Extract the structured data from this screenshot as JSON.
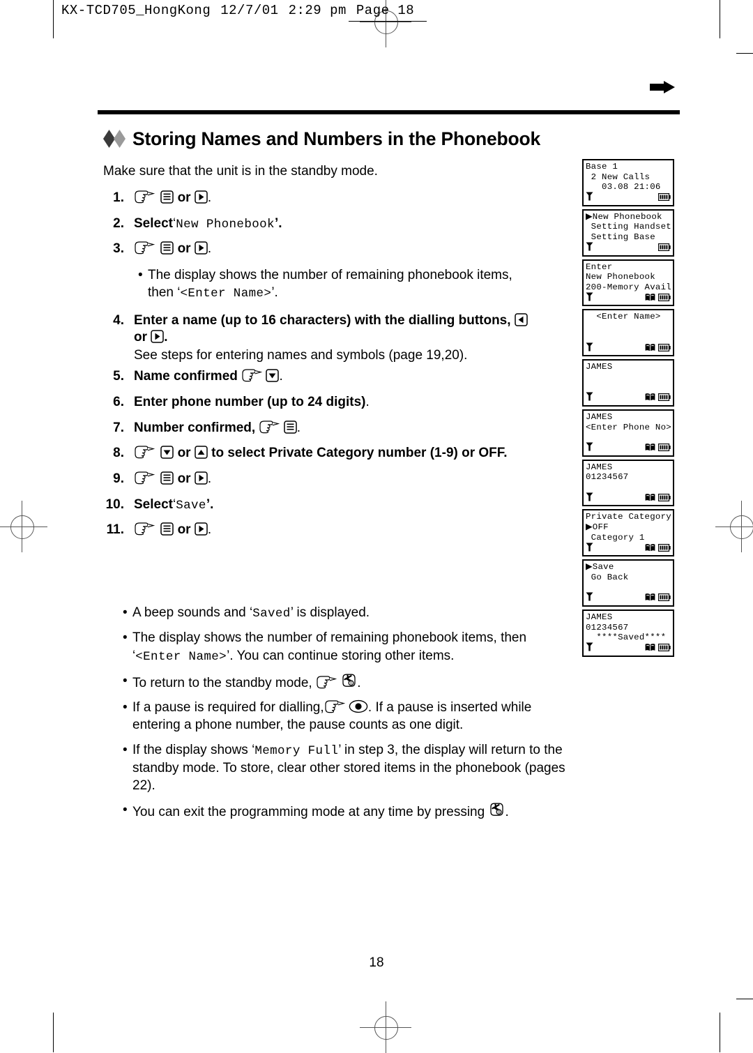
{
  "printer_slug": {
    "job": "KX-TCD705_HongKong",
    "date": "12/7/01",
    "time": "2:29 pm",
    "page_label": "Page 18"
  },
  "page": {
    "title": "Storing Names and Numbers in the Phonebook",
    "intro": "Make sure that the unit is in the standby mode.",
    "folio": "18",
    "arrow_icon": "right-arrow-icon"
  },
  "steps": [
    {
      "num": "1.",
      "kind": "icons",
      "prefix": "",
      "icons": [
        "hand-pointer-icon",
        "menu-key-icon"
      ],
      "joiner": "or",
      "icon2": "right-key-icon",
      "suffix": "."
    },
    {
      "num": "2.",
      "kind": "select",
      "label": "Select",
      "quote_open": "‘",
      "value": "New Phonebook",
      "quote_close": "’."
    },
    {
      "num": "3.",
      "kind": "icons",
      "prefix": "",
      "icons": [
        "hand-pointer-icon",
        "menu-key-icon"
      ],
      "joiner": "or",
      "icon2": "right-key-icon",
      "suffix": "."
    },
    {
      "num": "4.",
      "kind": "text",
      "text_a": "Enter a name (up to 16 characters) with the dialling buttons,",
      "joiner": "or",
      "suffix": ".",
      "note": "See steps for entering names and symbols (page 19,20)."
    },
    {
      "num": "5.",
      "kind": "text",
      "text_a": "Name confirmed",
      "suffix": "."
    },
    {
      "num": "6.",
      "kind": "text",
      "text_a": "Enter phone number (up to 24 digits)",
      "suffix": "."
    },
    {
      "num": "7.",
      "kind": "text",
      "text_a": "Number confirmed,",
      "suffix": "."
    },
    {
      "num": "8.",
      "kind": "text",
      "text_a": "to select Private Category number (1-9) or OFF.",
      "joiner": "or"
    },
    {
      "num": "9.",
      "kind": "icons",
      "prefix": "",
      "icons": [
        "hand-pointer-icon",
        "menu-key-icon"
      ],
      "joiner": "or",
      "icon2": "right-key-icon",
      "suffix": "."
    },
    {
      "num": "10.",
      "kind": "select",
      "label": "Select",
      "quote_open": "‘",
      "value": "Save",
      "quote_close": "’."
    },
    {
      "num": "11.",
      "kind": "icons",
      "prefix": "",
      "icons": [
        "hand-pointer-icon",
        "menu-key-icon"
      ],
      "joiner": "or",
      "icon2": "right-key-icon",
      "suffix": "."
    }
  ],
  "step3_note": {
    "line1": "The display shows the number of remaining phonebook items,",
    "line2_pre": "then ‘",
    "line2_mono": "<Enter Name>",
    "line2_post": "’."
  },
  "notes": [
    {
      "id": "note-beep",
      "pre": "A beep sounds and ‘",
      "mono": "Saved",
      "post": "’ is displayed."
    },
    {
      "id": "note-remaining",
      "pre": "The display shows the number of remaining phonebook items, then ‘",
      "mono": "<Enter Name>",
      "post": "’. You can continue storing other items."
    },
    {
      "id": "note-standby",
      "pre": "To return to the standby mode,",
      "post": "."
    },
    {
      "id": "note-pause",
      "pre": "If a pause is required for dialling,",
      "post": ". If a pause is inserted while entering a phone number, the pause counts as one digit."
    },
    {
      "id": "note-memory-full",
      "pre": "If the display shows ‘",
      "mono": "Memory Full",
      "post": "’ in step 3, the display will return to the standby mode. To store, clear other stored items in the phonebook (pages 22)."
    },
    {
      "id": "note-exit",
      "pre": "You can exit the programming mode at any time by pressing",
      "post": "."
    }
  ],
  "lcd_screens": [
    {
      "id": "lcd-standby",
      "lines": [
        "Base 1",
        " 2 New Calls",
        "   03.08 21:06"
      ],
      "status_left": "antenna-icon",
      "status_right": [
        "battery-icon"
      ]
    },
    {
      "id": "lcd-main-menu",
      "lines": [
        "▶New Phonebook",
        " Setting Handset",
        " Setting Base"
      ],
      "status_left": "antenna-icon",
      "status_right": [
        "battery-icon"
      ]
    },
    {
      "id": "lcd-enter-new-phonebook",
      "lines": [
        "Enter",
        "New Phonebook",
        "200-Memory Avail"
      ],
      "status_left": "antenna-icon",
      "status_right": [
        "phonebook-icon",
        "battery-icon"
      ]
    },
    {
      "id": "lcd-enter-name",
      "lines": [
        "  <Enter Name>",
        "",
        ""
      ],
      "status_left": "antenna-icon",
      "status_right": [
        "phonebook-icon",
        "battery-icon"
      ]
    },
    {
      "id": "lcd-name-james",
      "lines": [
        "JAMES",
        "",
        ""
      ],
      "status_left": "antenna-icon",
      "status_right": [
        "phonebook-icon",
        "battery-icon"
      ]
    },
    {
      "id": "lcd-enter-phone-no",
      "lines": [
        "JAMES",
        "<Enter Phone No>",
        ""
      ],
      "status_left": "antenna-icon",
      "status_right": [
        "phonebook-icon",
        "battery-icon"
      ]
    },
    {
      "id": "lcd-number-entered",
      "lines": [
        "JAMES",
        "01234567",
        ""
      ],
      "status_left": "antenna-icon",
      "status_right": [
        "phonebook-icon",
        "battery-icon"
      ]
    },
    {
      "id": "lcd-private-category",
      "lines": [
        "Private Category",
        "▶OFF",
        " Category 1"
      ],
      "status_left": "antenna-icon",
      "status_right": [
        "phonebook-icon",
        "battery-icon"
      ]
    },
    {
      "id": "lcd-save-goback",
      "lines": [
        "▶Save",
        " Go Back",
        ""
      ],
      "status_left": "antenna-icon",
      "status_right": [
        "phonebook-icon",
        "battery-icon"
      ]
    },
    {
      "id": "lcd-saved",
      "lines": [
        "JAMES",
        "01234567",
        "  ****Saved****"
      ],
      "status_left": "antenna-icon",
      "status_right": [
        "phonebook-icon",
        "battery-icon"
      ]
    }
  ]
}
